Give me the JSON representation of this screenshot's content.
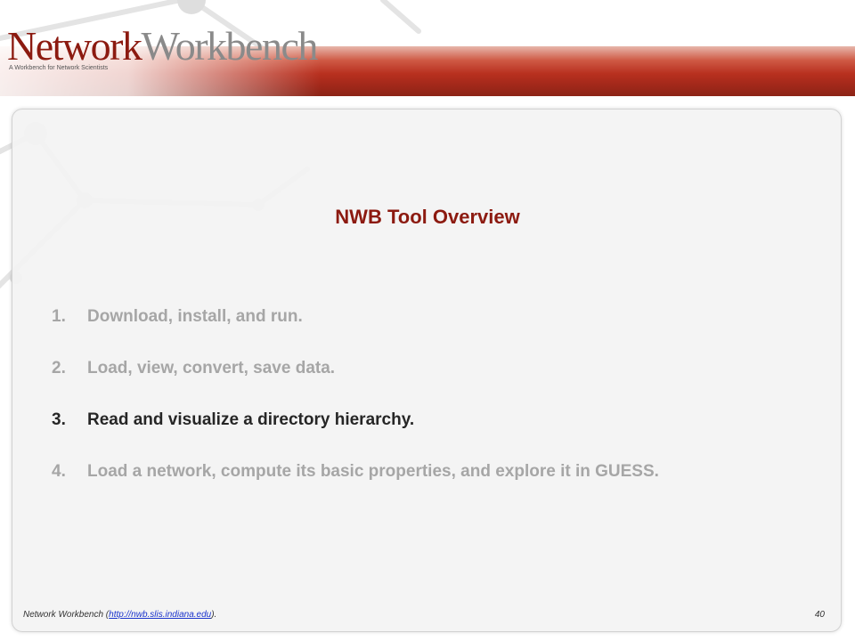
{
  "header": {
    "logo_part_a": "Network",
    "logo_part_b": "Workbench",
    "tagline": "A Workbench for Network Scientists"
  },
  "slide": {
    "title": "NWB Tool Overview",
    "items": [
      {
        "number": "1.",
        "text": "Download, install, and run.",
        "state": "dimmed"
      },
      {
        "number": "2.",
        "text": "Load, view, convert, save data.",
        "state": "dimmed"
      },
      {
        "number": "3.",
        "text": "Read and visualize a directory hierarchy.",
        "state": "active"
      },
      {
        "number": "4.",
        "text": "Load a network, compute its basic properties, and explore it in GUESS.",
        "state": "dimmed"
      }
    ]
  },
  "footer": {
    "prefix": "Network Workbench (",
    "link_text": "http://nwb.slis.indiana.edu",
    "suffix": ").",
    "page_number": "40"
  },
  "colors": {
    "brand_red": "#8c1a10",
    "dimmed_text": "#a6a6a6",
    "active_text": "#262626",
    "link": "#1a33cc"
  }
}
